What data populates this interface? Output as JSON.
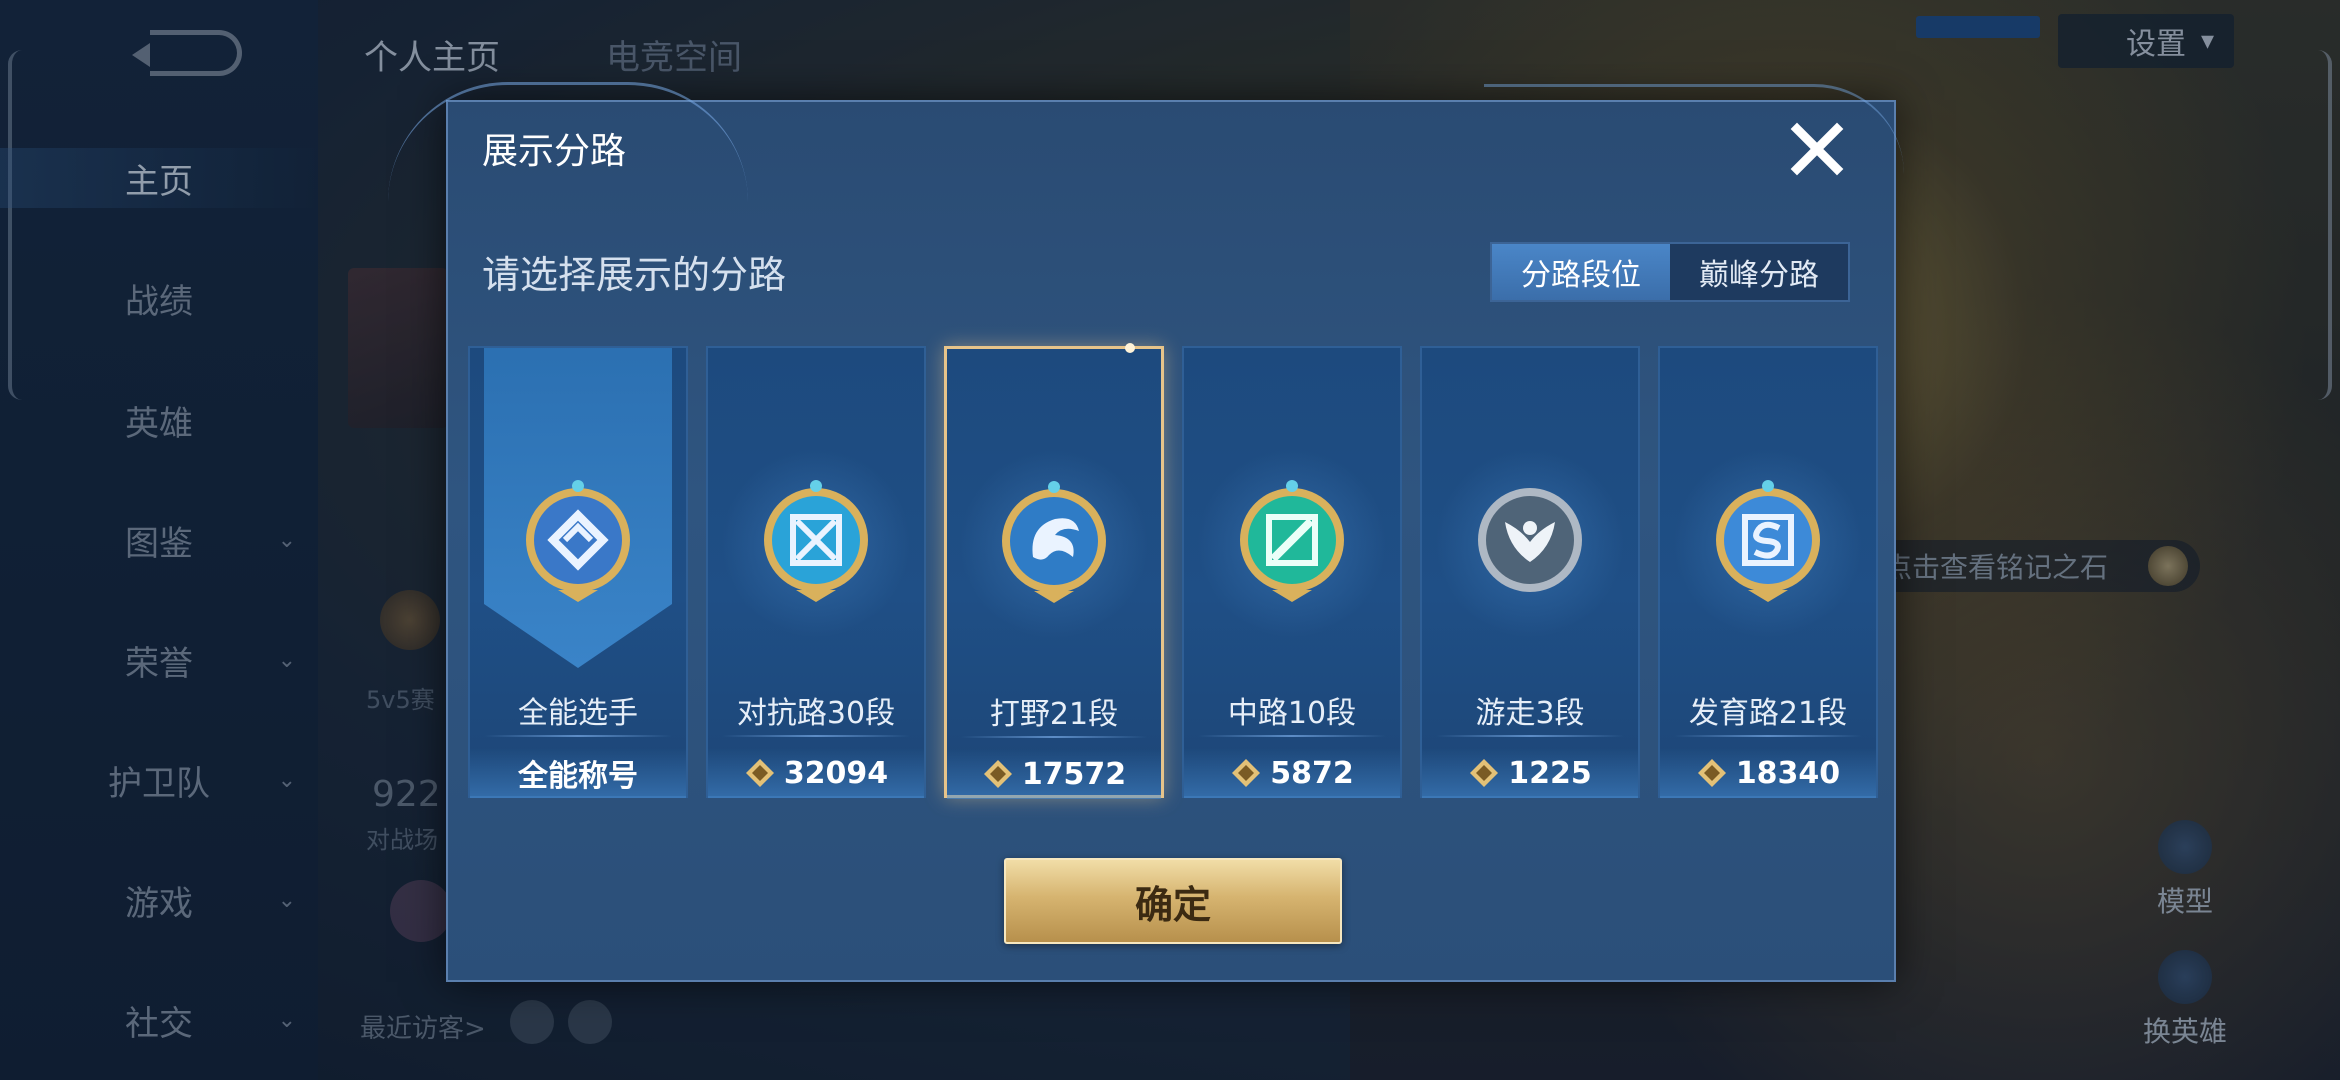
{
  "background": {
    "top_tabs": [
      "个人主页",
      "电竞空间"
    ],
    "sidebar": [
      {
        "label": "主页",
        "active": true
      },
      {
        "label": "战绩"
      },
      {
        "label": "英雄"
      },
      {
        "label": "图鉴",
        "chevron": true
      },
      {
        "label": "荣誉",
        "chevron": true
      },
      {
        "label": "护卫队",
        "chevron": true
      },
      {
        "label": "游戏",
        "chevron": true
      },
      {
        "label": "社交",
        "chevron": true
      }
    ],
    "settings_label": "设置",
    "rune_hint": "点击查看铭记之石",
    "model_label": "模型",
    "swap_hero_label": "换英雄",
    "visitors_label": "最近访客>",
    "mode_label": "5v5赛",
    "stat_number": "922",
    "stat_label": "对战场"
  },
  "modal": {
    "title": "展示分路",
    "subtitle": "请选择展示的分路",
    "toggle": [
      {
        "label": "分路段位",
        "active": true
      },
      {
        "label": "巅峰分路",
        "active": false
      }
    ],
    "cards": [
      {
        "rank": "全能选手",
        "score": "全能称号",
        "icon": "all-round-badge-icon",
        "has_points": false,
        "selected": false,
        "banner": true
      },
      {
        "rank": "对抗路30段",
        "score": "32094",
        "icon": "clash-lane-badge-icon",
        "has_points": true,
        "selected": false
      },
      {
        "rank": "打野21段",
        "score": "17572",
        "icon": "jungle-badge-icon",
        "has_points": true,
        "selected": true
      },
      {
        "rank": "中路10段",
        "score": "5872",
        "icon": "mid-lane-badge-icon",
        "has_points": true,
        "selected": false
      },
      {
        "rank": "游走3段",
        "score": "1225",
        "icon": "roam-badge-icon",
        "has_points": true,
        "selected": false
      },
      {
        "rank": "发育路21段",
        "score": "18340",
        "icon": "farm-lane-badge-icon",
        "has_points": true,
        "selected": false
      }
    ],
    "confirm_label": "确定"
  },
  "colors": {
    "accent_gold": "#e7c48a",
    "modal_bg": "#2f5580",
    "toggle_active": "#4a86c8"
  }
}
